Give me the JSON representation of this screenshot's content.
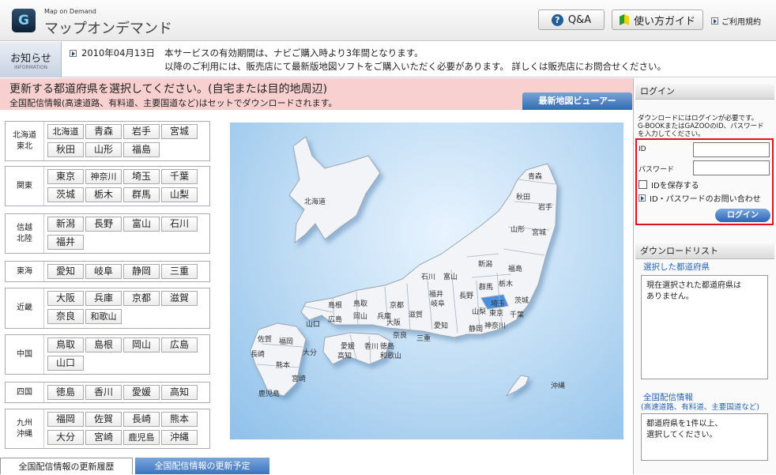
{
  "header": {
    "logo_letter": "G",
    "app_subtitle": "Map on Demand",
    "app_title": "マップオンデマンド",
    "qa_label": "Q&A",
    "guide_label": "使い方ガイド",
    "terms_label": "ご利用規約"
  },
  "news": {
    "label": "お知らせ",
    "label_en": "INFORMATION",
    "date": "2010年04月13日",
    "line1": "本サービスの有効期間は、ナビご購入時より3年間となります。",
    "line2": "以降のご利用には、販売店にて最新版地図ソフトをご購入いただく必要があります。 詳しくは販売店にお問合せください。"
  },
  "instruction": {
    "line1": "更新する都道府県を選択してください。(自宅または目的地周辺)",
    "line2": "全国配信情報(高速道路、有料道、主要国道など)はセットでダウンロードされます。",
    "viewer_button": "最新地図ビューアー"
  },
  "regions": [
    {
      "label": [
        "北海道",
        "東北"
      ],
      "prefs": [
        "北海道",
        "青森",
        "岩手",
        "宮城",
        "秋田",
        "山形",
        "福島"
      ]
    },
    {
      "label": [
        "関東"
      ],
      "prefs": [
        "東京",
        "神奈川",
        "埼玉",
        "千葉",
        "茨城",
        "栃木",
        "群馬",
        "山梨"
      ]
    },
    {
      "label": [
        "信越",
        "北陸"
      ],
      "prefs": [
        "新潟",
        "長野",
        "富山",
        "石川",
        "福井"
      ]
    },
    {
      "label": [
        "東海"
      ],
      "prefs": [
        "愛知",
        "岐阜",
        "静岡",
        "三重"
      ]
    },
    {
      "label": [
        "近畿"
      ],
      "prefs": [
        "大阪",
        "兵庫",
        "京都",
        "滋賀",
        "奈良",
        "和歌山"
      ]
    },
    {
      "label": [
        "中国"
      ],
      "prefs": [
        "鳥取",
        "島根",
        "岡山",
        "広島",
        "山口"
      ]
    },
    {
      "label": [
        "四国"
      ],
      "prefs": [
        "徳島",
        "香川",
        "愛媛",
        "高知"
      ]
    },
    {
      "label": [
        "九州",
        "沖縄"
      ],
      "prefs": [
        "福岡",
        "佐賀",
        "長崎",
        "熊本",
        "大分",
        "宮崎",
        "鹿児島",
        "沖縄"
      ]
    }
  ],
  "map_labels": [
    "北海道",
    "青森",
    "秋田",
    "岩手",
    "山形",
    "宮城",
    "新潟",
    "福島",
    "石川",
    "富山",
    "群馬",
    "栃木",
    "福井",
    "長野",
    "埼玉",
    "茨城",
    "島根",
    "鳥取",
    "京都",
    "岐阜",
    "山梨",
    "東京",
    "千葉",
    "山口",
    "広島",
    "岡山",
    "兵庫",
    "大阪",
    "滋賀",
    "愛知",
    "静岡",
    "神奈川",
    "佐賀",
    "福岡",
    "大分",
    "愛媛",
    "香川",
    "徳島",
    "奈良",
    "三重",
    "長崎",
    "熊本",
    "高知",
    "和歌山",
    "宮崎",
    "鹿児島",
    "沖縄"
  ],
  "colors": {
    "selected_pref": "#4a90e0",
    "pink_banner": "#f9d0d0",
    "login_highlight": "#e0101c"
  },
  "login": {
    "header": "ログイン",
    "intro": [
      "ダウンロードにはログインが必要です。",
      "G-BOOKまたはGAZOOのID、パスワード",
      "を入力してください。"
    ],
    "id_label": "ID",
    "password_label": "パスワード",
    "save_id_label": "IDを保存する",
    "inquiry_label": "ID・パスワードのお問い合わせ",
    "button": "ログイン"
  },
  "download": {
    "header": "ダウンロードリスト",
    "selected_label": "選択した都道府県",
    "selected_text": [
      "現在選択された都道府県は",
      "ありません。"
    ],
    "nationwide_label": "全国配信情報",
    "nationwide_sub": "(高速道路、有料道、主要国道など)",
    "nationwide_text": [
      "都道府県を1件以上、",
      "選択してください。"
    ]
  },
  "tabs": [
    "全国配信情報の更新履歴",
    "全国配信情報の更新予定"
  ]
}
